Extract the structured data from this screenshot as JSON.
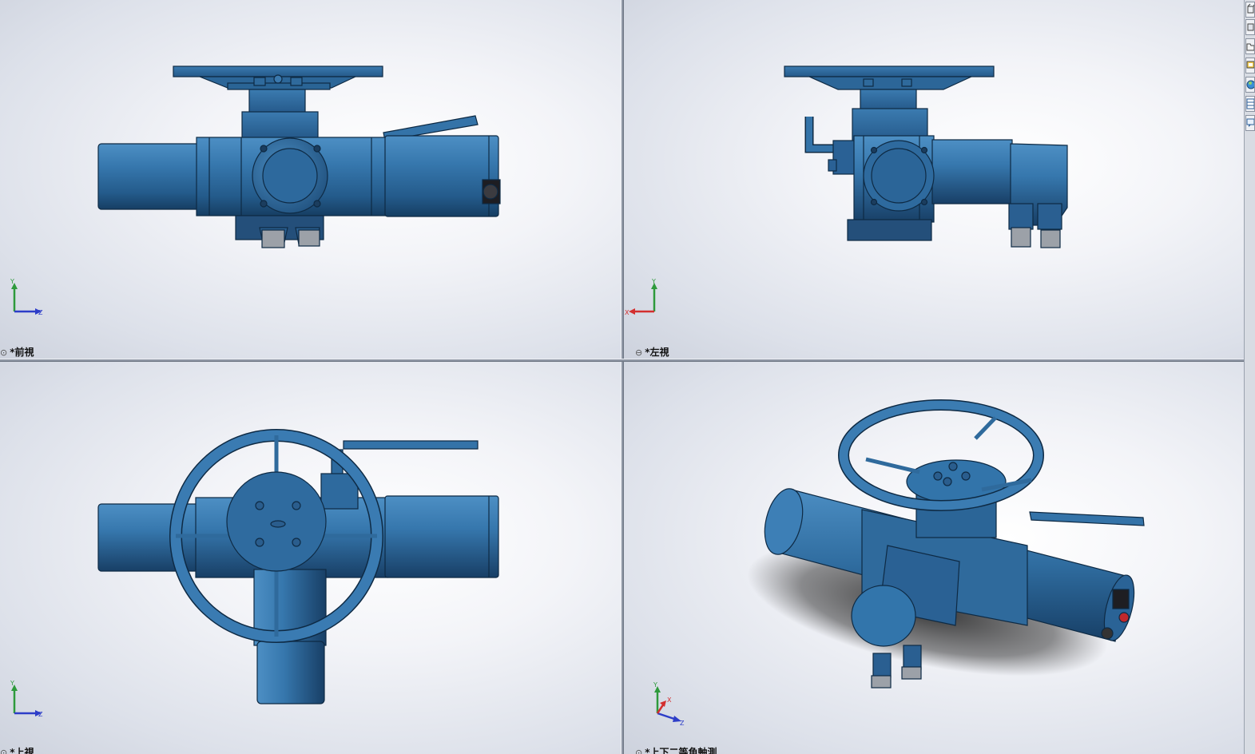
{
  "viewports": [
    {
      "id": "front",
      "label": "*前視",
      "link_icon": "view-link-icon",
      "triad": {
        "vertical": "Y",
        "horizontal": "Z"
      }
    },
    {
      "id": "left",
      "label": "*左視",
      "link_icon": "view-link-icon",
      "triad": {
        "vertical": "Y",
        "horizontal": "X"
      }
    },
    {
      "id": "top",
      "label": "*上視",
      "link_icon": "view-link-icon",
      "triad": {
        "vertical": "Y",
        "horizontal": "Z"
      }
    },
    {
      "id": "iso",
      "label": "*上下二等角軸測",
      "link_icon": "view-link-icon",
      "triad": {
        "vertical": "Y",
        "horizontal": "Z",
        "depth": "X"
      }
    }
  ],
  "toolbar": {
    "buttons": [
      "view-cube-icon",
      "box-icon",
      "folder-icon",
      "display-icon",
      "appearance-icon",
      "table-icon",
      "comment-icon"
    ]
  },
  "colors": {
    "model_body": "#2f6a9c",
    "model_edge": "#0e2a44",
    "axis_x": "#d32f2f",
    "axis_y": "#2e9a3c",
    "axis_z": "#2d3dc8"
  }
}
